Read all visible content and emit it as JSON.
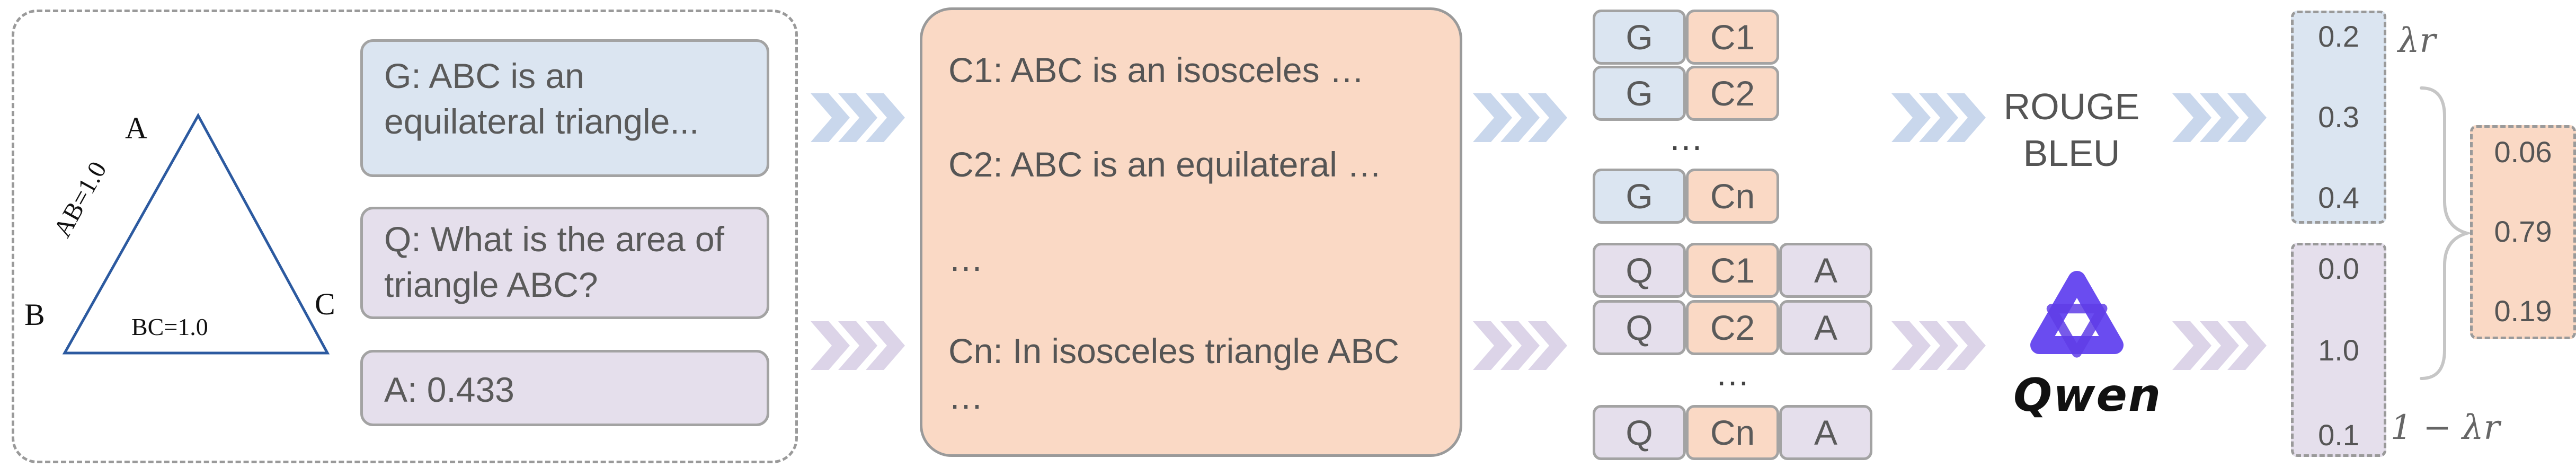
{
  "triangle": {
    "vertices": {
      "a": "A",
      "b": "B",
      "c": "C"
    },
    "side_ab": "AB=1.0",
    "side_bc": "BC=1.0"
  },
  "inputs": {
    "ground_truth": "G: ABC is an equilateral triangle...",
    "question": "Q: What is the area of triangle ABC?",
    "answer": "A: 0.433"
  },
  "candidates": [
    "C1: ABC is an isosceles …",
    "C2: ABC is an equilateral …",
    "…",
    "Cn: In isosceles triangle ABC …"
  ],
  "pairs_top": [
    [
      "G",
      "C1"
    ],
    [
      "G",
      "C2"
    ],
    [
      "G",
      "Cn"
    ]
  ],
  "pairs_bottom": [
    [
      "Q",
      "C1",
      "A"
    ],
    [
      "Q",
      "C2",
      "A"
    ],
    [
      "Q",
      "Cn",
      "A"
    ]
  ],
  "ellipsis": "…",
  "metrics": {
    "line1": "ROUGE",
    "line2": "BLEU"
  },
  "model_name": "Qwen",
  "scores_top": [
    "0.2",
    "0.3",
    "0.4"
  ],
  "scores_bottom": [
    "0.0",
    "1.0",
    "0.1"
  ],
  "lambda_top": "λr",
  "lambda_bottom": "1 − λr",
  "final_scores": [
    "0.06",
    "0.79",
    "0.19"
  ],
  "colors": {
    "blue": "#dbe5f1",
    "purple": "#e5dfec",
    "peach": "#fad9c5",
    "arrow_blue": "#c9d7ec",
    "arrow_purple": "#dcd4e8",
    "qwen": "#6a4cf0"
  }
}
